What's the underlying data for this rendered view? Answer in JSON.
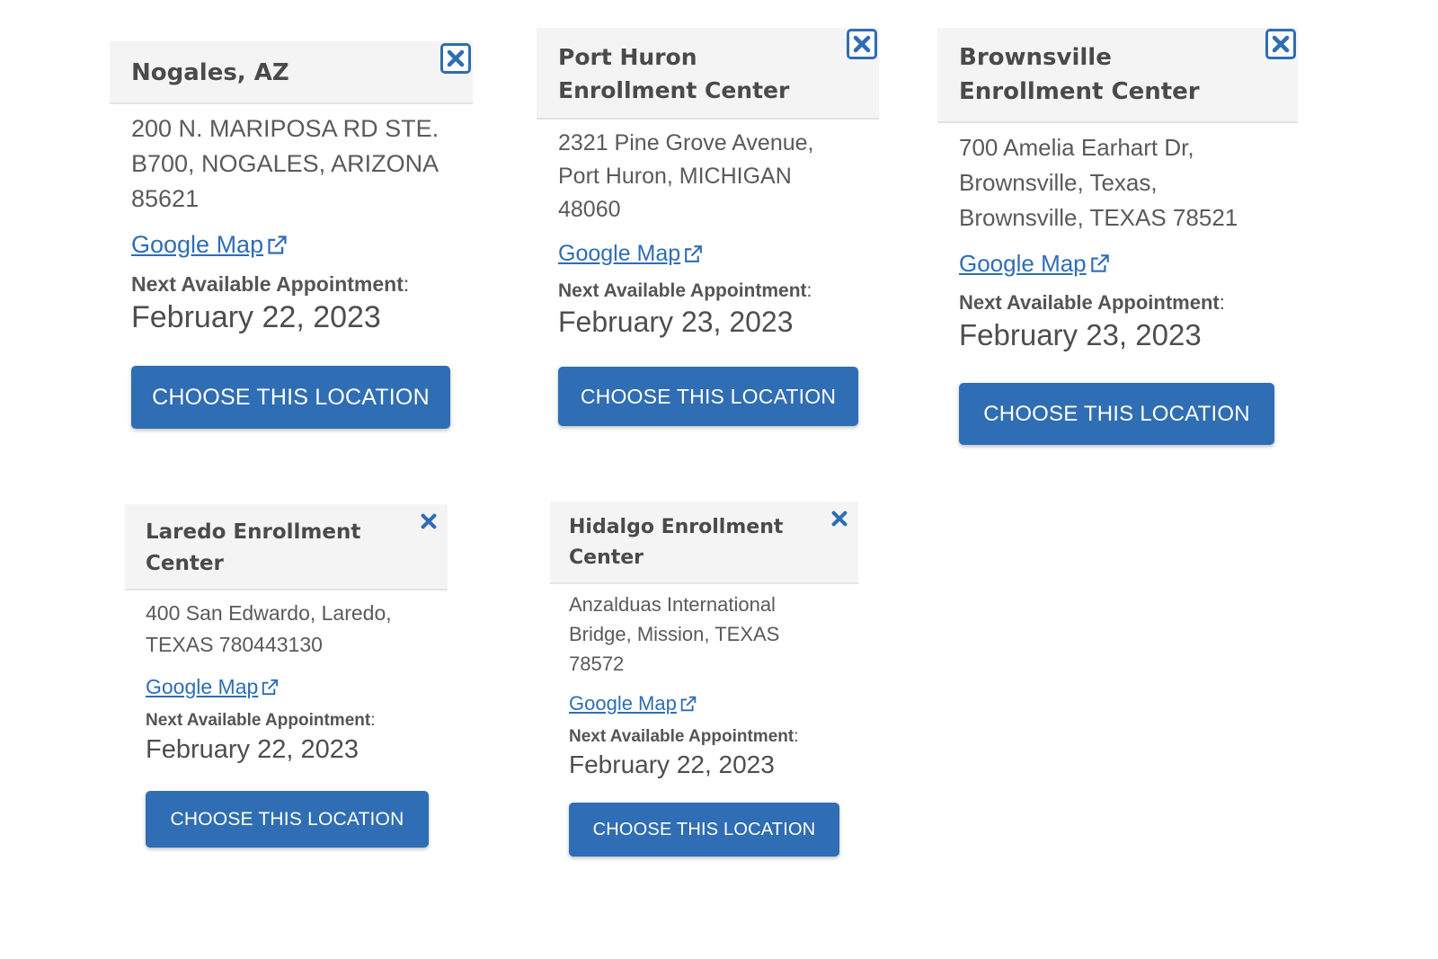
{
  "locations": [
    {
      "name": "Nogales, AZ",
      "address": "200 N. MARIPOSA RD STE. B700, NOGALES, ARIZONA 85621",
      "map_link": "Google Map",
      "appointment_label": "Next Available Appointment",
      "appointment_date": "February 22, 2023",
      "button_label": "CHOOSE THIS LOCATION"
    },
    {
      "name": "Port Huron Enrollment Center",
      "address": "2321 Pine Grove Avenue, Port Huron, MICHIGAN 48060",
      "map_link": "Google Map",
      "appointment_label": "Next Available Appointment",
      "appointment_date": "February 23, 2023",
      "button_label": "CHOOSE THIS LOCATION"
    },
    {
      "name": "Brownsville Enrollment Center",
      "address": "700 Amelia Earhart Dr, Brownsville, Texas, Brownsville, TEXAS 78521",
      "map_link": "Google Map",
      "appointment_label": "Next Available Appointment",
      "appointment_date": "February 23, 2023",
      "button_label": "CHOOSE THIS LOCATION"
    },
    {
      "name": "Laredo Enrollment Center",
      "address": "400 San Edwardo, Laredo, TEXAS 780443130",
      "map_link": "Google Map",
      "appointment_label": "Next Available Appointment",
      "appointment_date": "February 22, 2023",
      "button_label": "CHOOSE THIS LOCATION"
    },
    {
      "name": "Hidalgo Enrollment Center",
      "address": "Anzalduas International Bridge, Mission, TEXAS 78572",
      "map_link": "Google Map",
      "appointment_label": "Next Available Appointment",
      "appointment_date": "February 22, 2023",
      "button_label": "CHOOSE THIS LOCATION"
    }
  ],
  "icons": {
    "close": "close-icon",
    "external_link": "external-link-icon"
  },
  "colors": {
    "accent": "#2f6db4",
    "header_bg": "#f4f4f4",
    "text": "#505050"
  }
}
